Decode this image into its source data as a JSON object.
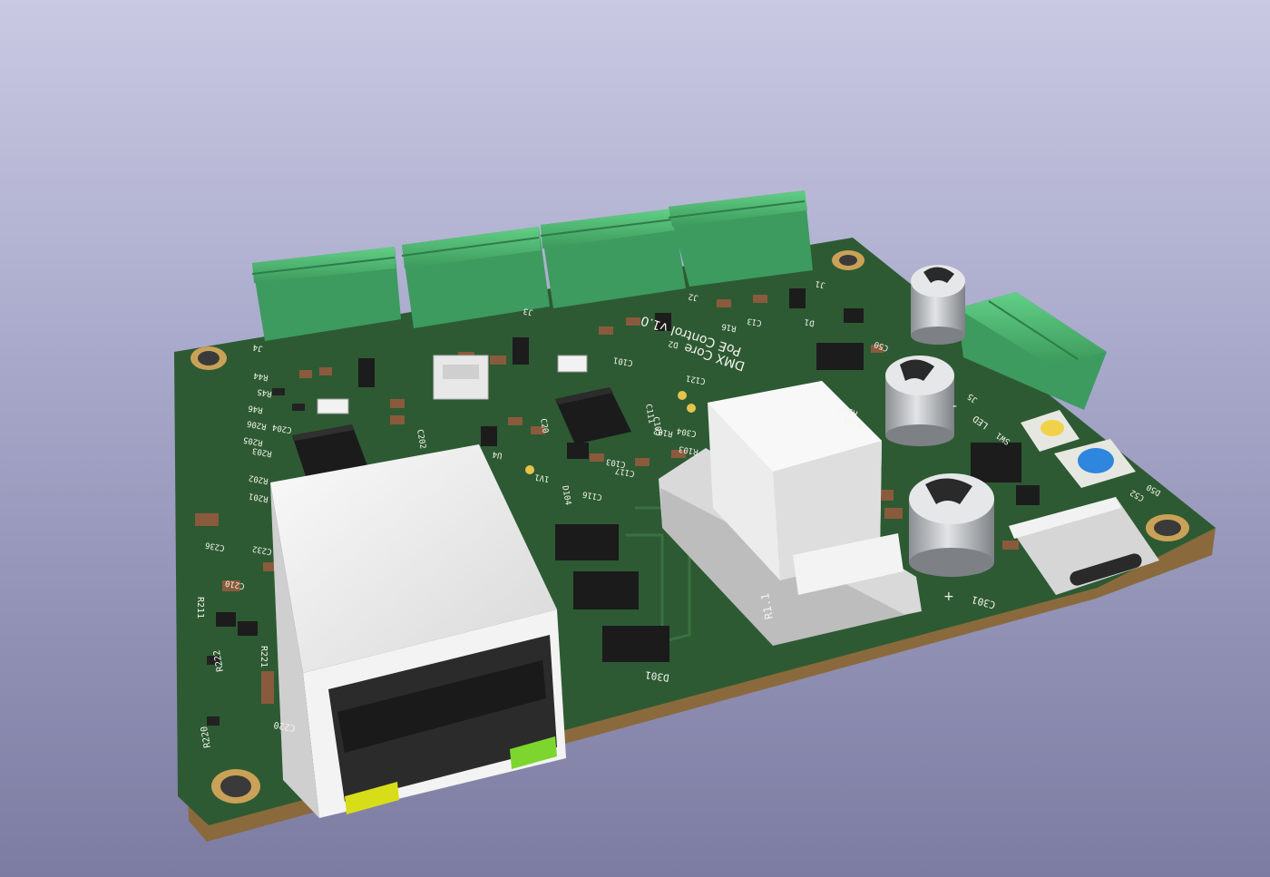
{
  "board_title": "DMX Core",
  "board_subtitle": "PoE Control v1.0",
  "silkscreen": {
    "refs_left": [
      "R44",
      "R45",
      "R46",
      "R206",
      "R205",
      "C204",
      "R203",
      "R202",
      "R201",
      "C236",
      "C232",
      "C210",
      "R211",
      "R221",
      "R222",
      "C220",
      "R220"
    ],
    "refs_center": [
      "C202",
      "C20",
      "C101",
      "C117",
      "C116",
      "D104",
      "C103",
      "C121",
      "C111",
      "C105",
      "C304",
      "R102",
      "R103",
      "1V1",
      "U4",
      "D2",
      "R16",
      "C13",
      "D1"
    ],
    "refs_right": [
      "C301",
      "D301",
      "R303",
      "R304",
      "C50",
      "C52",
      "D50",
      "LED",
      "SW1",
      "J5"
    ],
    "connector_labels": [
      "J4",
      "J3",
      "J2",
      "J1"
    ],
    "transformer_label": "R1.1",
    "power_marks": [
      "+",
      "-"
    ]
  },
  "components": {
    "terminal_blocks": [
      "J4",
      "J3",
      "J2",
      "J1",
      "J5"
    ],
    "ethernet_port": "RJ45 with integrated magnetics",
    "usb_port": "USB-C",
    "capacitors": [
      "C301",
      "C302",
      "C303"
    ],
    "buttons": [
      "SW1 (yellow)",
      "SW2 (blue)"
    ]
  },
  "colors": {
    "background_top": "#c9c9e3",
    "background_bottom": "#7c7ca2",
    "pcb": "#2d5a33",
    "pcb_edge": "#8a6a3c",
    "terminal_green": "#4fb872",
    "silkscreen": "#f4f4ec",
    "rj45_body": "#eeeeee",
    "led_yellow": "#d8dd1a",
    "led_green": "#7cd62e",
    "button_blue": "#2e86de",
    "button_yellow": "#f0d24a"
  }
}
